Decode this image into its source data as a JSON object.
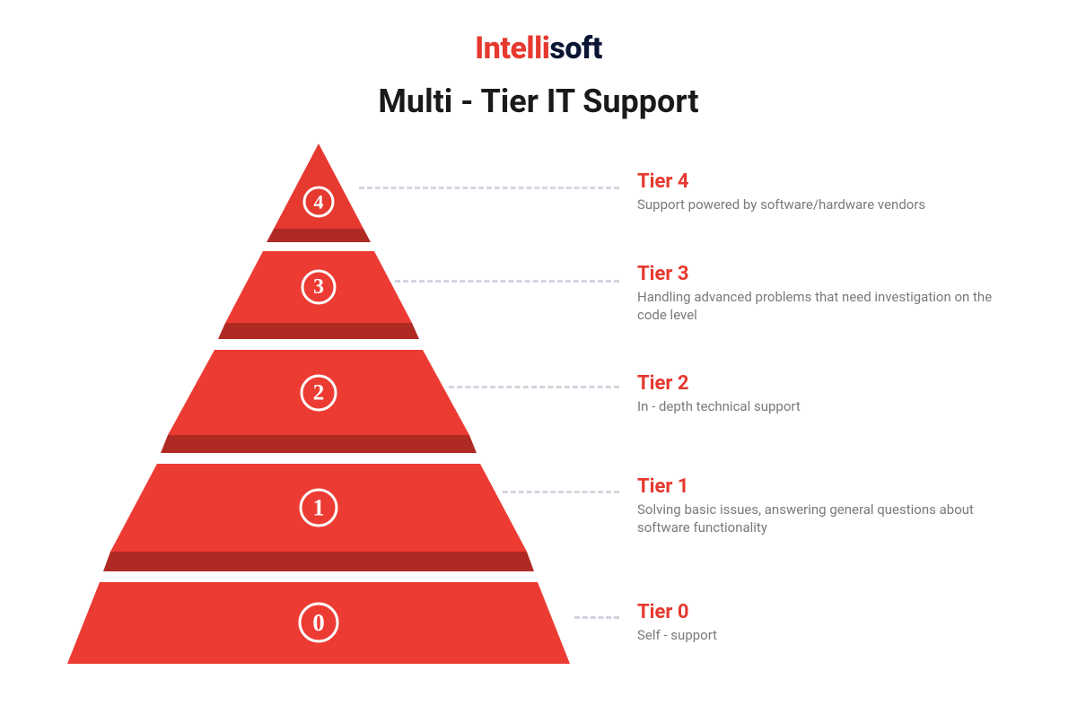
{
  "brand": {
    "part1": "Intelli",
    "part2": "soft"
  },
  "title": "Multi - Tier IT Support",
  "colors": {
    "accent": "#e6392f",
    "dark": "#0a1433",
    "grey": "#7a7a7a",
    "pyramid_face": "#ec3b33",
    "pyramid_shadow": "#b02a24"
  },
  "tiers": [
    {
      "level": "4",
      "title": "Tier 4",
      "desc": "Support powered by software/hardware vendors"
    },
    {
      "level": "3",
      "title": "Tier 3",
      "desc": "Handling advanced problems that need investigation on the code level"
    },
    {
      "level": "2",
      "title": "Tier 2",
      "desc": "In - depth technical support"
    },
    {
      "level": "1",
      "title": "Tier 1",
      "desc": "Solving basic issues, answering general questions about software functionality"
    },
    {
      "level": "0",
      "title": "Tier 0",
      "desc": "Self - support"
    }
  ]
}
